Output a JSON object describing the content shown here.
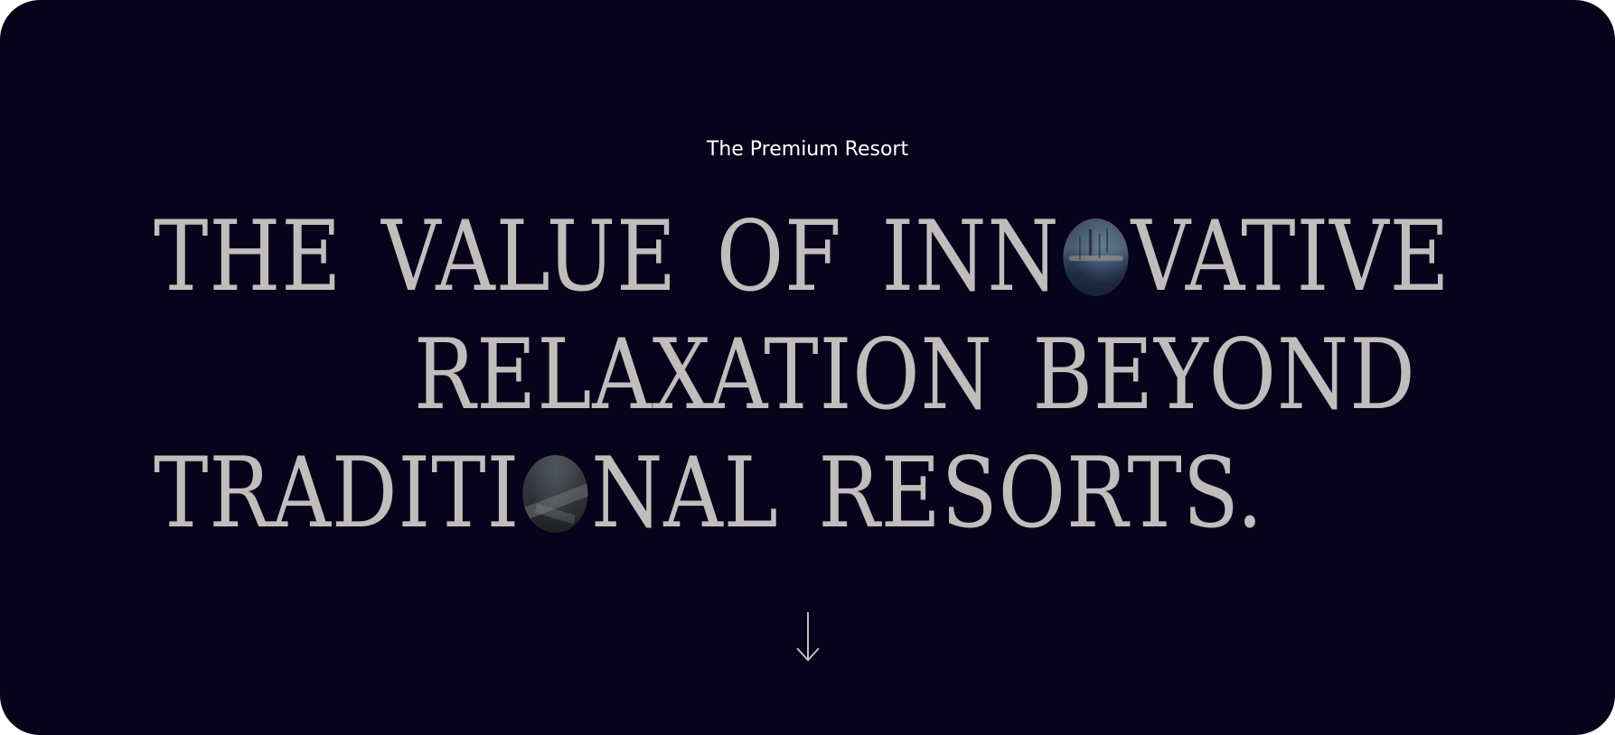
{
  "hero": {
    "eyebrow": "The Premium Resort",
    "headline": {
      "line1": {
        "word1": "THE",
        "word2": "VALUE",
        "word3": "OF",
        "word4_before": "INN",
        "word4_image": "pool-photo-letter-o",
        "word4_after": "VATIVE"
      },
      "line2": {
        "word1": "RELAXATION",
        "word2": "BEYOND"
      },
      "line3": {
        "word1_before": "TRADITI",
        "word1_image": "road-photo-letter-o",
        "word1_after": "NAL",
        "word2": "RESORTS."
      }
    },
    "scroll_icon": "arrow-down-icon",
    "colors": {
      "background": "#07031a",
      "headline": "#c0bdbc",
      "eyebrow": "#ffffff",
      "arrow": "#c0bdbc"
    }
  }
}
